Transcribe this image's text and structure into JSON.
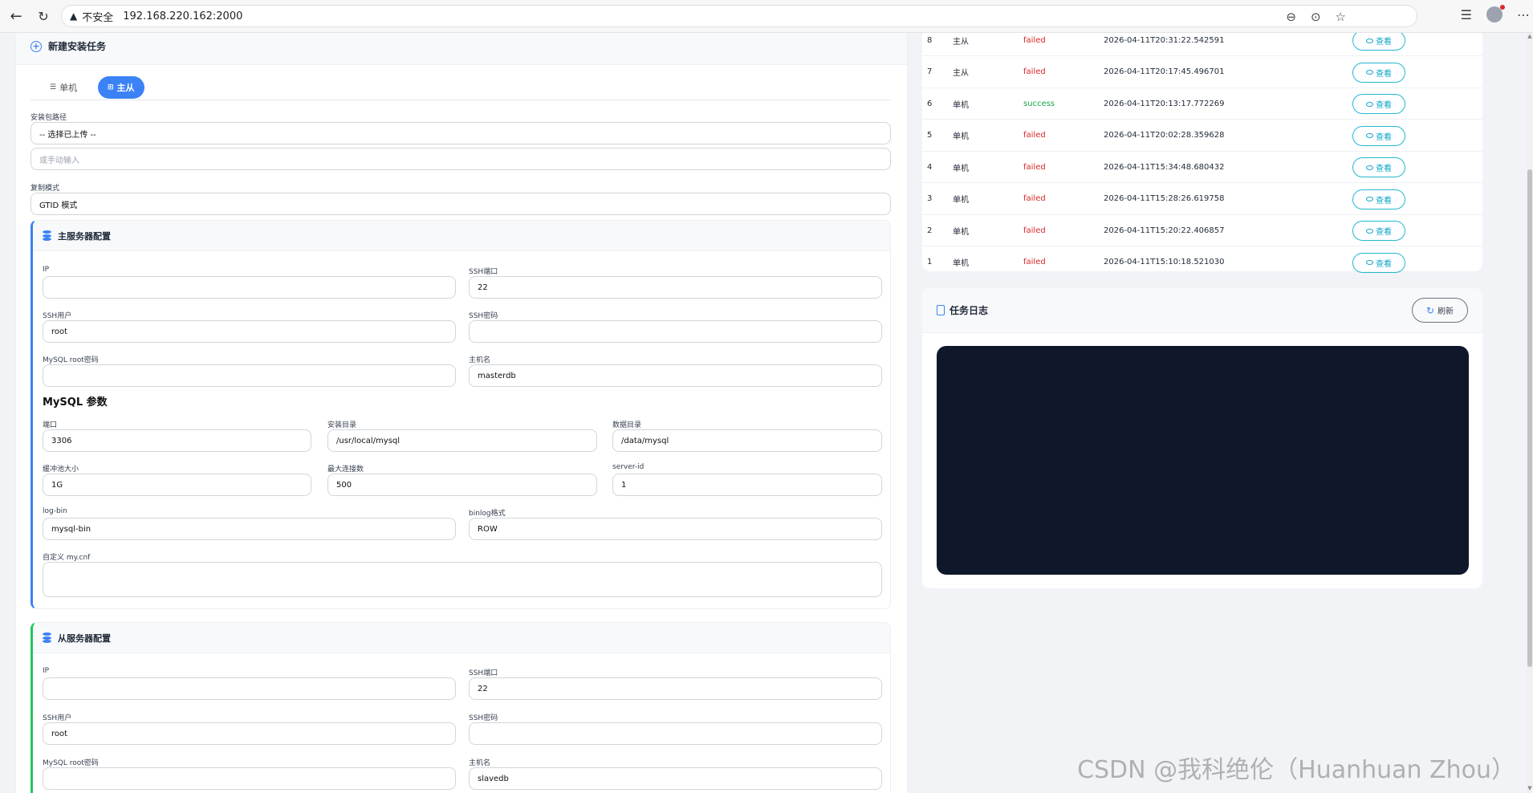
{
  "browser": {
    "security_label": "不安全",
    "url": "192.168.220.162:2000"
  },
  "form": {
    "title": "新建安装任务",
    "tabs": [
      {
        "label": "单机",
        "active": false
      },
      {
        "label": "主从",
        "active": true
      }
    ],
    "package_path_label": "安装包路径",
    "package_select": "-- 选择已上传 --",
    "package_manual_placeholder": "或手动输入",
    "replication_label": "复制模式",
    "replication_value": "GTID 模式",
    "master": {
      "title": "主服务器配置",
      "ip_label": "IP",
      "ip_value": "",
      "ssh_port_label": "SSH端口",
      "ssh_port_value": "22",
      "ssh_user_label": "SSH用户",
      "ssh_user_value": "root",
      "ssh_pass_label": "SSH密码",
      "ssh_pass_value": "",
      "mysql_root_label": "MySQL root密码",
      "mysql_root_value": "",
      "hostname_label": "主机名",
      "hostname_value": "masterdb",
      "params_title": "MySQL 参数",
      "port_label": "端口",
      "port_value": "3306",
      "install_dir_label": "安装目录",
      "install_dir_value": "/usr/local/mysql",
      "data_dir_label": "数据目录",
      "data_dir_value": "/data/mysql",
      "buffer_label": "缓冲池大小",
      "buffer_value": "1G",
      "maxconn_label": "最大连接数",
      "maxconn_value": "500",
      "server_id_label": "server-id",
      "server_id_value": "1",
      "logbin_label": "log-bin",
      "logbin_value": "mysql-bin",
      "binlog_fmt_label": "binlog格式",
      "binlog_fmt_value": "ROW",
      "mycnf_label": "自定义 my.cnf"
    },
    "slave": {
      "title": "从服务器配置",
      "ip_label": "IP",
      "ssh_port_label": "SSH端口",
      "ssh_port_value": "22",
      "ssh_user_label": "SSH用户",
      "ssh_user_value": "root",
      "ssh_pass_label": "SSH密码",
      "mysql_root_label": "MySQL root密码",
      "hostname_label": "主机名",
      "hostname_value": "slavedb"
    }
  },
  "tasks": {
    "view_label": "查看",
    "rows": [
      {
        "id": "8",
        "mode": "主从",
        "status": "failed",
        "time": "2026-04-11T20:31:22.542591"
      },
      {
        "id": "7",
        "mode": "主从",
        "status": "failed",
        "time": "2026-04-11T20:17:45.496701"
      },
      {
        "id": "6",
        "mode": "单机",
        "status": "success",
        "time": "2026-04-11T20:13:17.772269"
      },
      {
        "id": "5",
        "mode": "单机",
        "status": "failed",
        "time": "2026-04-11T20:02:28.359628"
      },
      {
        "id": "4",
        "mode": "单机",
        "status": "failed",
        "time": "2026-04-11T15:34:48.680432"
      },
      {
        "id": "3",
        "mode": "单机",
        "status": "failed",
        "time": "2026-04-11T15:28:26.619758"
      },
      {
        "id": "2",
        "mode": "单机",
        "status": "failed",
        "time": "2026-04-11T15:20:22.406857"
      },
      {
        "id": "1",
        "mode": "单机",
        "status": "failed",
        "time": "2026-04-11T15:10:18.521030"
      }
    ]
  },
  "log": {
    "title": "任务日志",
    "refresh_label": "刷新"
  },
  "watermark": "CSDN @我科绝伦（Huanhuan Zhou）"
}
